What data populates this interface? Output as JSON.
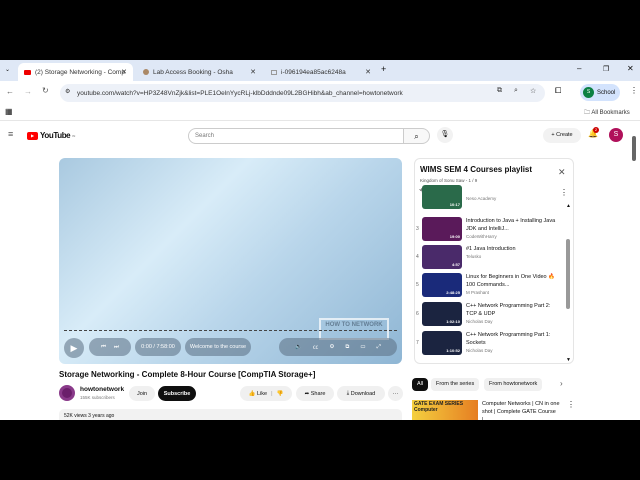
{
  "browser": {
    "tabs": [
      {
        "title": "(2) Storage Networking - Comp",
        "active": true
      },
      {
        "title": "Lab Access Booking - Osha"
      },
      {
        "title": "i-096194ea85ac6248a"
      }
    ],
    "url": "youtube.com/watch?v=HP3Z48VnZjk&list=PLE1OelnYycRLj-klbDddnde09L2BGHibh&ab_channel=howtonetwork",
    "profile": "School",
    "profile_initial": "S",
    "bookmarks": "All Bookmarks"
  },
  "youtube": {
    "logo": "YouTube",
    "region": "IN",
    "search_placeholder": "Search",
    "create": "Create",
    "notifications": "2",
    "avatar": "S",
    "player": {
      "time": "0:00 / 7:58:00",
      "chapter": "Welcome to the course",
      "watermark": "HOW TO NETWORK"
    },
    "video": {
      "title": "Storage Networking - Complete 8-Hour Course [CompTIA Storage+]",
      "channel": "howtonetwork",
      "subscribers": "155K subscribers",
      "join": "Join",
      "subscribe": "Subscribe",
      "like": "Like",
      "share": "Share",
      "download": "Download",
      "meta": "52K views  3 years ago"
    },
    "playlist": {
      "title": "WIMS SEM 4 Courses playlist",
      "subtitle": "Kingdom of Sonu Saw - 1 / 9",
      "items": [
        {
          "idx": "",
          "title": "",
          "channel": "Neso Academy",
          "duration": "10:17",
          "color": "#2a6a4a"
        },
        {
          "idx": "3",
          "title": "Introduction to Java + Installing Java JDK and IntelliJ...",
          "channel": "CodeWithHarry",
          "duration": "19:00",
          "color": "#5a1a5a"
        },
        {
          "idx": "4",
          "title": "#1 Java Introduction",
          "channel": "Telusko",
          "duration": "4:57",
          "color": "#4a2a6a"
        },
        {
          "idx": "5",
          "title": "Linux for Beginners in One Video 🔥 100 Commands...",
          "channel": "M Prashant",
          "duration": "2:48:25",
          "color": "#1a2a7a"
        },
        {
          "idx": "6",
          "title": "C++ Network Programming Part 2: TCP & UDP",
          "channel": "Nicholas Day",
          "duration": "1:02:10",
          "color": "#1b2440"
        },
        {
          "idx": "7",
          "title": "C++ Network Programming Part 1: Sockets",
          "channel": "Nicholas Day",
          "duration": "1:10:52",
          "color": "#1b2440"
        }
      ]
    },
    "chips": [
      "All",
      "From the series",
      "From howtonetwork"
    ],
    "rec": {
      "title": "Computer Networks | CN in one shot | Complete GATE Course |...",
      "thumb": "GATE EXAM SERIES Computer"
    }
  }
}
